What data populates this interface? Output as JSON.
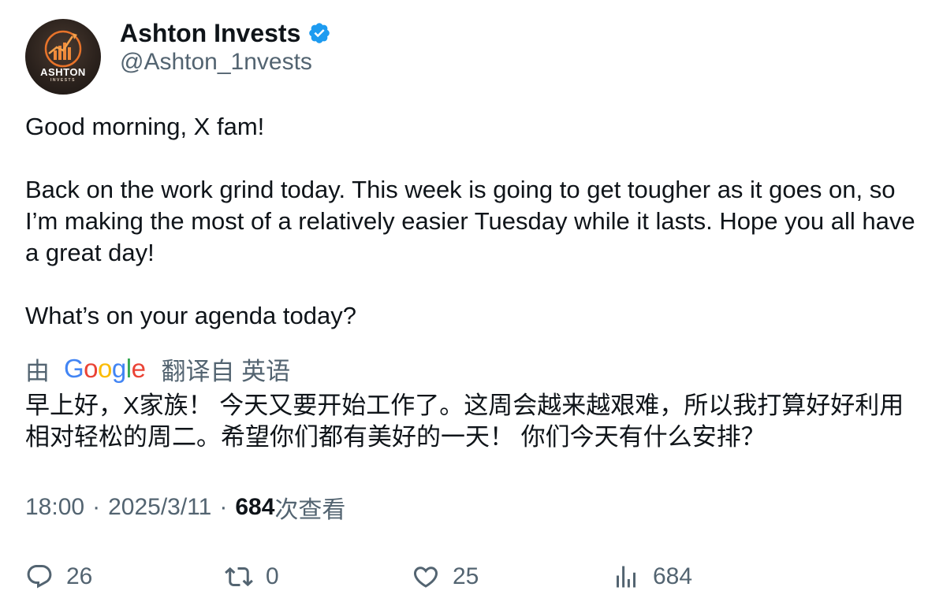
{
  "author": {
    "display_name": "Ashton Invests",
    "handle": "@Ashton_1nvests",
    "verified": true,
    "avatar_text": "ASHTON",
    "avatar_subtext": "INVESTS"
  },
  "tweet": {
    "line1": "Good morning, X fam!",
    "line2": "Back on the work grind today. This week is going to get tougher as it goes on, so I’m making the most of a relatively easier Tuesday while it lasts. Hope you all have a great day!",
    "line3": "What’s on your agenda today?"
  },
  "translation": {
    "prefix": "由",
    "provider": "Google",
    "suffix": "翻译自 英语",
    "text": "早上好，X家族！ 今天又要开始工作了。这周会越来越艰难，所以我打算好好利用相对轻松的周二。希望你们都有美好的一天！ 你们今天有什么安排？"
  },
  "meta": {
    "time": "18:00",
    "date": "2025/3/11",
    "views": "684",
    "views_label": "次查看",
    "separator": "·"
  },
  "actions": {
    "replies": "26",
    "retweets": "0",
    "likes": "25",
    "views": "684"
  },
  "colors": {
    "primary_text": "#0f1419",
    "secondary_text": "#536471",
    "verified_badge": "#1d9bf0"
  },
  "icons": {
    "verified": "verified-badge-icon",
    "reply": "reply-icon",
    "retweet": "retweet-icon",
    "like": "heart-icon",
    "views": "analytics-icon"
  }
}
